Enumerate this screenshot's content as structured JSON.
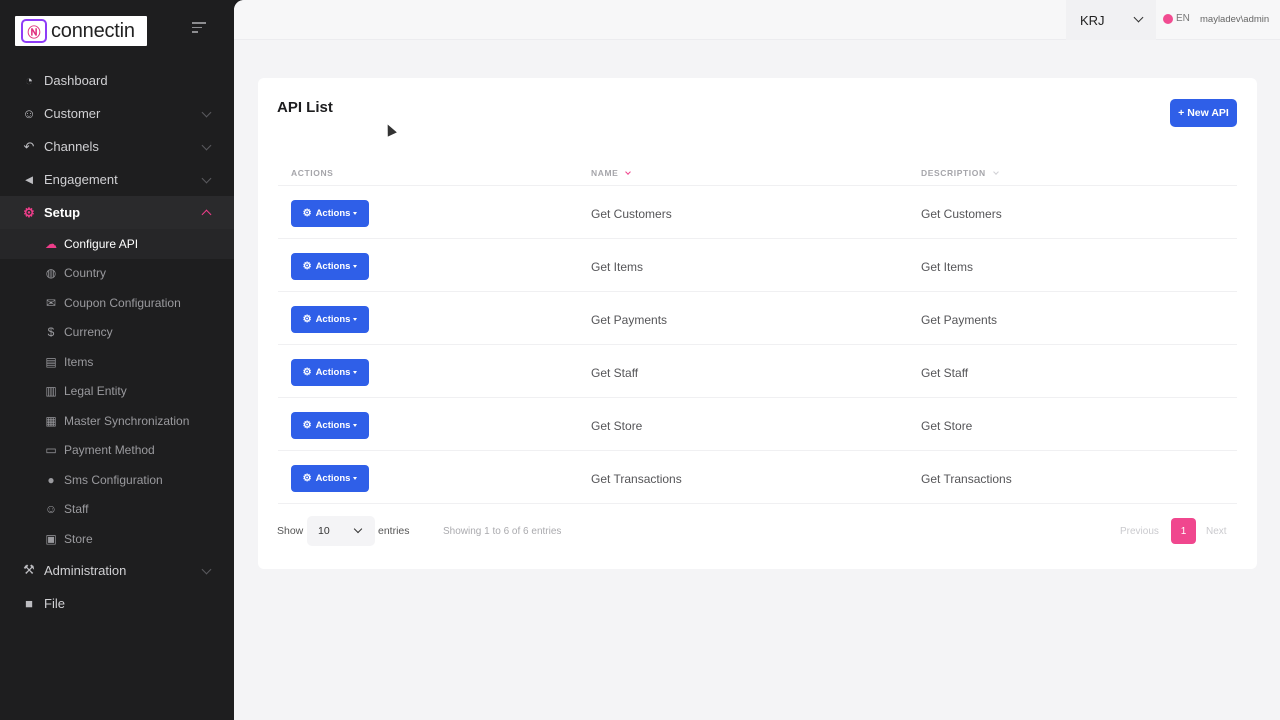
{
  "brand": {
    "logo_mark": "Ⓝ",
    "name": "connectin"
  },
  "sidebar": {
    "items": [
      {
        "label": "Dashboard",
        "icon": "dashboard-icon",
        "glyph": "◔"
      },
      {
        "label": "Customer",
        "icon": "user-icon",
        "glyph": "☺"
      },
      {
        "label": "Channels",
        "icon": "reply-icon",
        "glyph": "↶"
      },
      {
        "label": "Engagement",
        "icon": "megaphone-icon",
        "glyph": "◄"
      },
      {
        "label": "Setup",
        "icon": "gear-icon",
        "glyph": "⚙"
      },
      {
        "label": "Administration",
        "icon": "wrench-icon",
        "glyph": "⚒"
      },
      {
        "label": "File",
        "icon": "folder-icon",
        "glyph": "■"
      }
    ],
    "setup_children": [
      {
        "label": "Configure API",
        "icon": "cloud-icon",
        "glyph": "☁"
      },
      {
        "label": "Country",
        "icon": "globe-icon",
        "glyph": "◍"
      },
      {
        "label": "Coupon Configuration",
        "icon": "envelope-icon",
        "glyph": "✉"
      },
      {
        "label": "Currency",
        "icon": "dollar-icon",
        "glyph": "$"
      },
      {
        "label": "Items",
        "icon": "cart-icon",
        "glyph": "▤"
      },
      {
        "label": "Legal Entity",
        "icon": "building-icon",
        "glyph": "▥"
      },
      {
        "label": "Master Synchronization",
        "icon": "calendar-icon",
        "glyph": "▦"
      },
      {
        "label": "Payment Method",
        "icon": "credit-card-icon",
        "glyph": "▭"
      },
      {
        "label": "Sms Configuration",
        "icon": "chat-icon",
        "glyph": "●"
      },
      {
        "label": "Staff",
        "icon": "person-icon",
        "glyph": "☺"
      },
      {
        "label": "Store",
        "icon": "store-icon",
        "glyph": "▣"
      }
    ]
  },
  "topbar": {
    "store": "KRJ",
    "language": "EN",
    "user": "mayladev\\admin"
  },
  "page": {
    "title": "API List",
    "new_button": "+ New API",
    "columns": {
      "actions": "ACTIONS",
      "name": "NAME",
      "description": "DESCRIPTION"
    },
    "action_label": "Actions",
    "rows": [
      {
        "name": "Get Customers",
        "description": "Get Customers"
      },
      {
        "name": "Get Items",
        "description": "Get Items"
      },
      {
        "name": "Get Payments",
        "description": "Get Payments"
      },
      {
        "name": "Get Staff",
        "description": "Get Staff"
      },
      {
        "name": "Get Store",
        "description": "Get Store"
      },
      {
        "name": "Get Transactions",
        "description": "Get Transactions"
      }
    ],
    "footer": {
      "show": "Show",
      "page_length": "10",
      "entries": "entries",
      "info": "Showing 1 to 6 of 6 entries",
      "previous": "Previous",
      "current_page": "1",
      "next": "Next"
    }
  },
  "colors": {
    "accent": "#2f5fe8",
    "brand_pink": "#ee3d8a",
    "sidebar_bg": "#1e1e1f"
  }
}
